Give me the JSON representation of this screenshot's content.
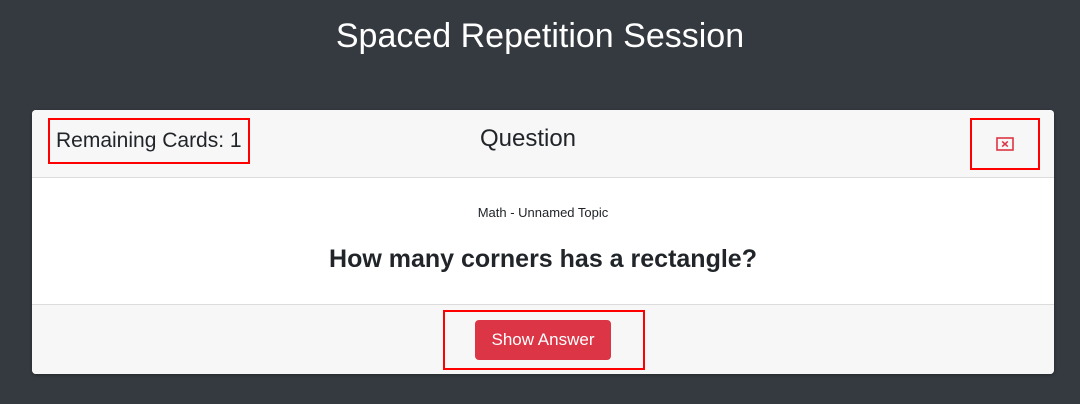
{
  "page": {
    "title": "Spaced Repetition Session"
  },
  "card": {
    "remaining_label": "Remaining Cards: 1",
    "header_title": "Question",
    "close_icon": "close-square-icon",
    "topic": "Math - Unnamed Topic",
    "question": "How many corners has a rectangle?",
    "show_answer_label": "Show Answer"
  },
  "colors": {
    "background": "#343a40",
    "accent_button": "#dc3545",
    "highlight_border": "#ff0000",
    "close_icon": "#dc3545"
  }
}
